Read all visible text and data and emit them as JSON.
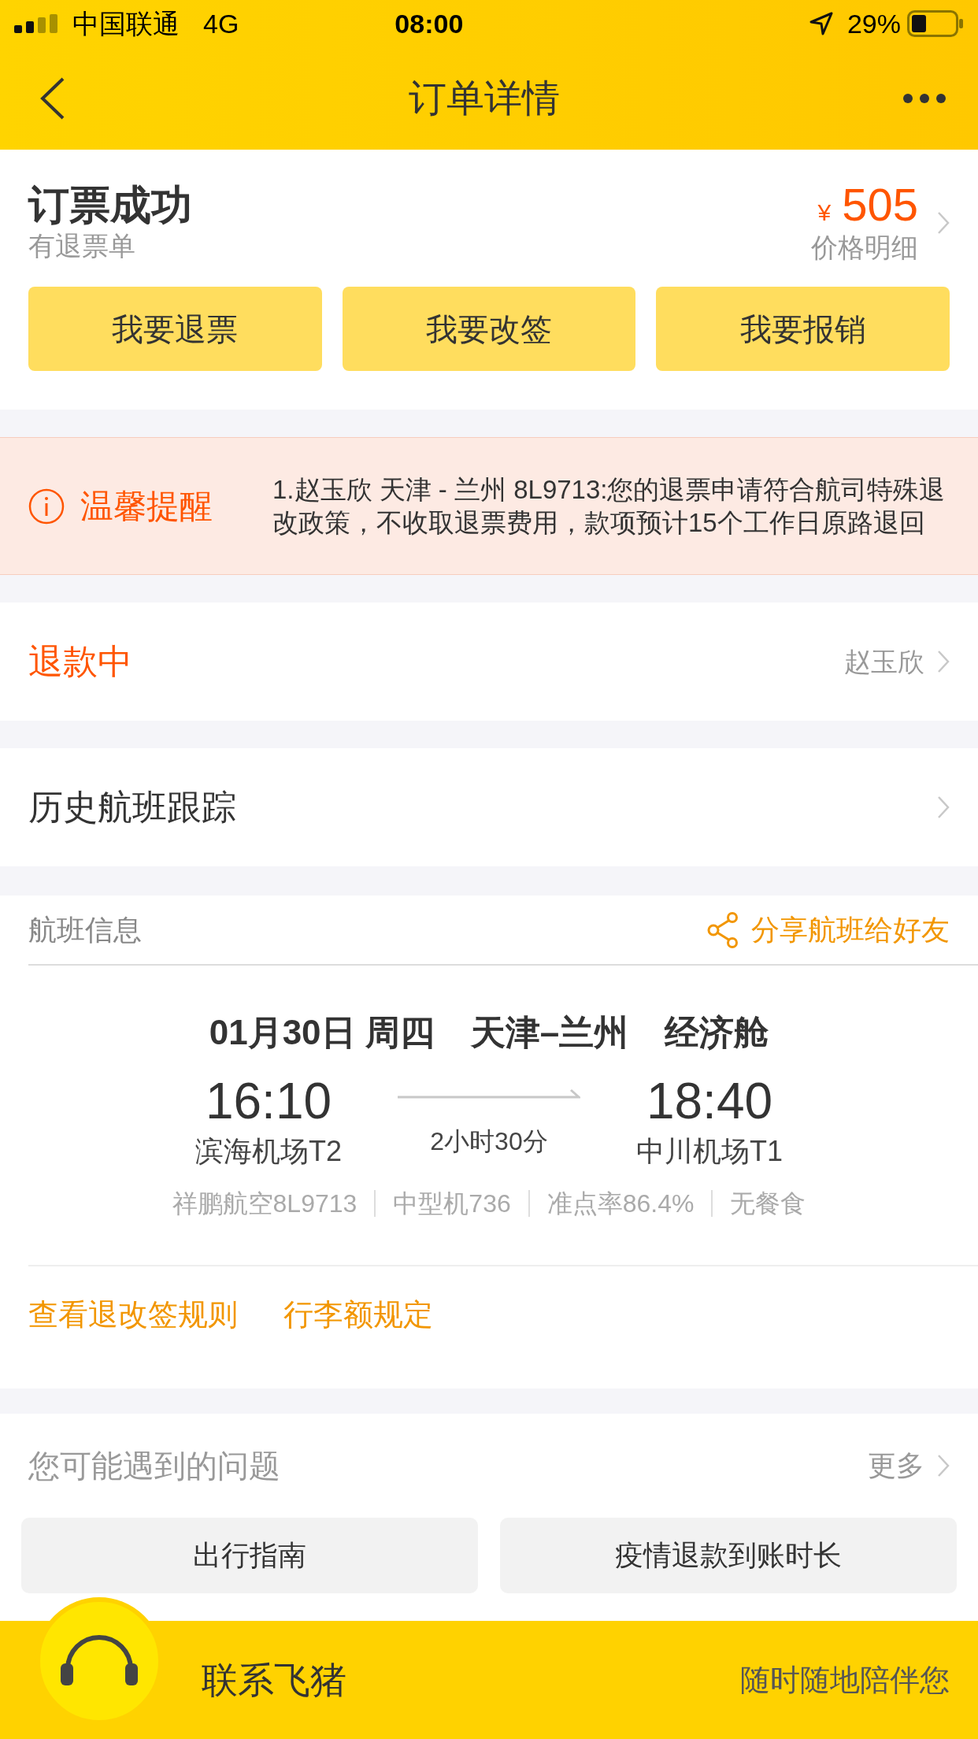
{
  "status_bar": {
    "carrier": "中国联通",
    "network": "4G",
    "time": "08:00",
    "battery": "29%"
  },
  "nav": {
    "title": "订单详情"
  },
  "order": {
    "status": "订票成功",
    "note": "有退票单",
    "currency": "¥",
    "price": "505",
    "price_link": "价格明细",
    "actions": [
      "我要退票",
      "我要改签",
      "我要报销"
    ]
  },
  "notice": {
    "label": "温馨提醒",
    "text": "1.赵玉欣 天津 - 兰州 8L9713:您的退票申请符合航司特殊退改政策，不收取退票费用，款项预计15个工作日原路退回"
  },
  "refund": {
    "status": "退款中",
    "passenger": "赵玉欣"
  },
  "history": {
    "label": "历史航班跟踪"
  },
  "flight": {
    "heading": "航班信息",
    "share": "分享航班给好友",
    "date": "01月30日",
    "weekday": "周四",
    "route": "天津–兰州",
    "cabin": "经济舱",
    "depart_time": "16:10",
    "depart_airport": "滨海机场T2",
    "duration": "2小时30分",
    "arrive_time": "18:40",
    "arrive_airport": "中川机场T1",
    "details": [
      "祥鹏航空8L9713",
      "中型机736",
      "准点率86.4%",
      "无餐食"
    ],
    "links": [
      "查看退改签规则",
      "行李额规定"
    ]
  },
  "questions": {
    "heading": "您可能遇到的问题",
    "more": "更多",
    "items": [
      "出行指南",
      "疫情退款到账时长"
    ]
  },
  "contact": {
    "label": "联系飞猪",
    "slogan": "随时随地陪伴您"
  }
}
